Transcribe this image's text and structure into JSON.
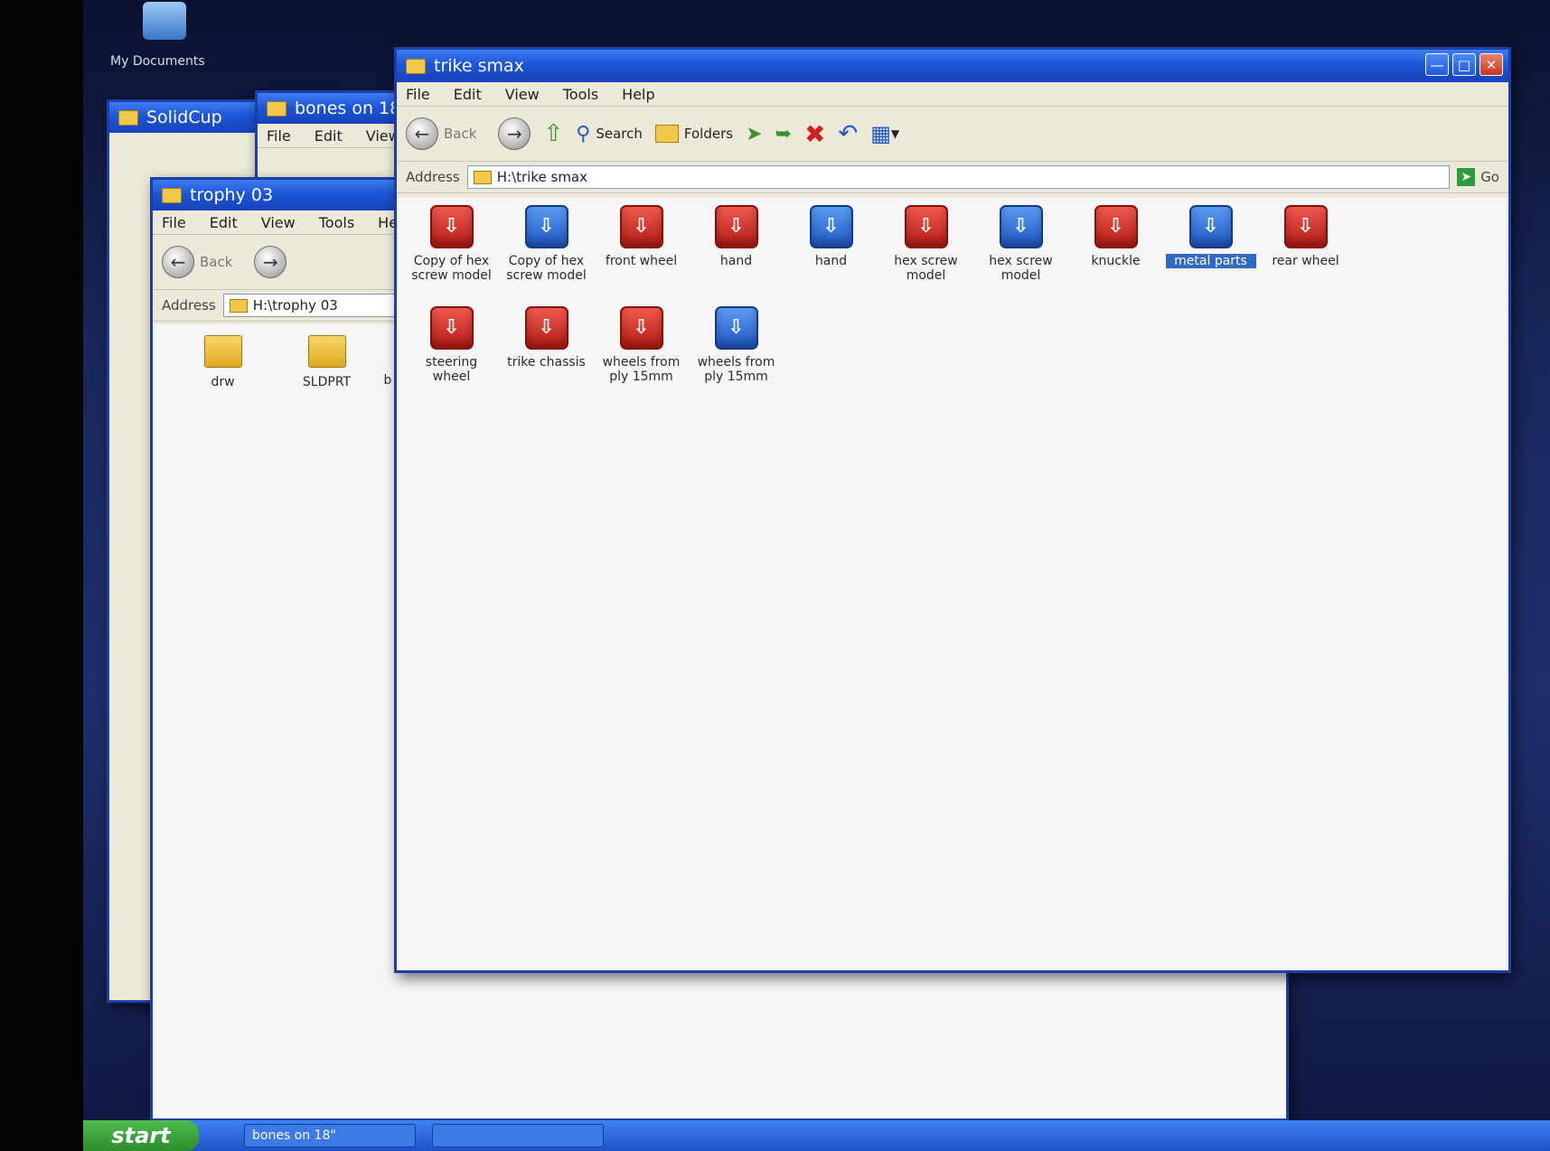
{
  "desktop": {
    "icon_label": "My Documents",
    "taskbar": {
      "start_label": "start",
      "items": [
        "bones on 18\"",
        ""
      ]
    }
  },
  "windows": {
    "behind1": {
      "title": "SolidCup"
    },
    "behind2": {
      "title": "bones on 18",
      "menu": [
        "File",
        "Edit",
        "View"
      ]
    },
    "trophy": {
      "title": "trophy 03",
      "menu": [
        "File",
        "Edit",
        "View",
        "Tools",
        "He"
      ],
      "back_label": "Back",
      "address_label": "Address",
      "address_value": "H:\\trophy 03",
      "items": [
        {
          "label": "drw"
        },
        {
          "label": "SLDPRT"
        },
        {
          "label": "b"
        }
      ]
    },
    "trike": {
      "title": "trike smax",
      "menu": [
        "File",
        "Edit",
        "View",
        "Tools",
        "Help"
      ],
      "toolbar": {
        "back": "Back",
        "search": "Search",
        "folders": "Folders"
      },
      "address_label": "Address",
      "address_value": "H:\\trike smax",
      "go_label": "Go",
      "items": [
        {
          "label": "Copy of hex screw model",
          "type": "part"
        },
        {
          "label": "Copy of hex screw model",
          "type": "asm"
        },
        {
          "label": "front wheel",
          "type": "part"
        },
        {
          "label": "hand",
          "type": "part"
        },
        {
          "label": "hand",
          "type": "asm"
        },
        {
          "label": "hex screw model",
          "type": "part"
        },
        {
          "label": "hex screw model",
          "type": "asm"
        },
        {
          "label": "knuckle",
          "type": "part"
        },
        {
          "label": "metal parts",
          "type": "asm",
          "selected": true
        },
        {
          "label": "rear wheel",
          "type": "part"
        },
        {
          "label": "steering wheel",
          "type": "part"
        },
        {
          "label": "trike chassis",
          "type": "part"
        },
        {
          "label": "wheels from ply 15mm",
          "type": "part"
        },
        {
          "label": "wheels from ply 15mm",
          "type": "asm"
        }
      ]
    }
  },
  "colors": {
    "titlebar": "#1d56d8",
    "part_icon": "#c8241d",
    "assembly_icon": "#2a63cf",
    "selection": "#316ac5"
  }
}
